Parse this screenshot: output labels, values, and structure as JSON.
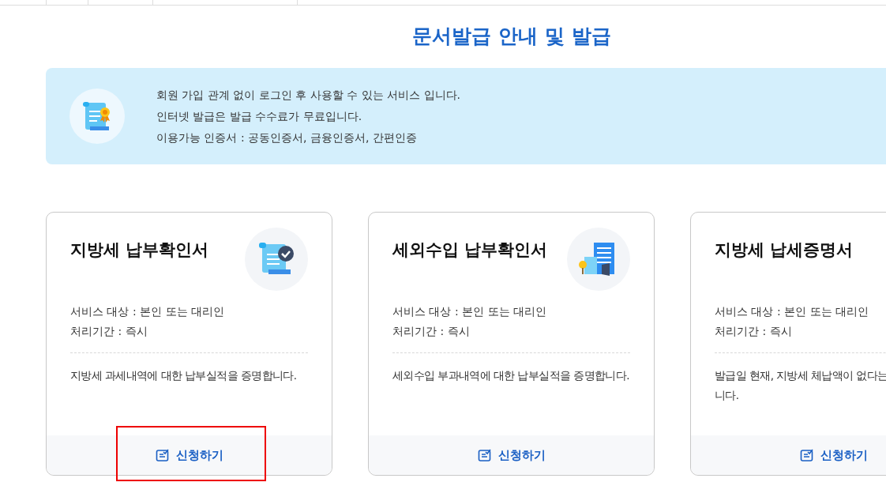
{
  "page_title": "문서발급 안내 및 발급",
  "notice": {
    "lines": [
      "회원 가입 관계 없이 로그인 후 사용할 수 있는 서비스 입니다.",
      "인터넷 발급은 발급 수수료가 무료입니다.",
      "이용가능 인증서 : 공동인증서, 금융인증서, 간편인증"
    ]
  },
  "cards": [
    {
      "title": "지방세 납부확인서",
      "kind": "document",
      "info": [
        "서비스 대상 : 본인 또는 대리인",
        "처리기간 : 즉시"
      ],
      "description": [
        "지방세 과세내역에 대한 납부실적을 증명합니다."
      ],
      "button": {
        "label": "신청하기",
        "highlighted": true
      }
    },
    {
      "title": "세외수입 납부확인서",
      "kind": "building",
      "info": [
        "서비스 대상 : 본인 또는 대리인",
        "처리기간 : 즉시"
      ],
      "description": [
        "세외수입 부과내역에 대한 납부실적을 증명합니다."
      ],
      "button": {
        "label": "신청하기",
        "highlighted": false
      }
    },
    {
      "title": "지방세 납세증명서",
      "kind": "plain",
      "info": [
        "서비스 대상 : 본인 또는 대리인",
        "처리기간 : 즉시"
      ],
      "description": [
        "발급일 현재, 지방세 체납액이 없다는",
        "니다."
      ],
      "button": {
        "label": "신청하기",
        "highlighted": false
      }
    }
  ]
}
